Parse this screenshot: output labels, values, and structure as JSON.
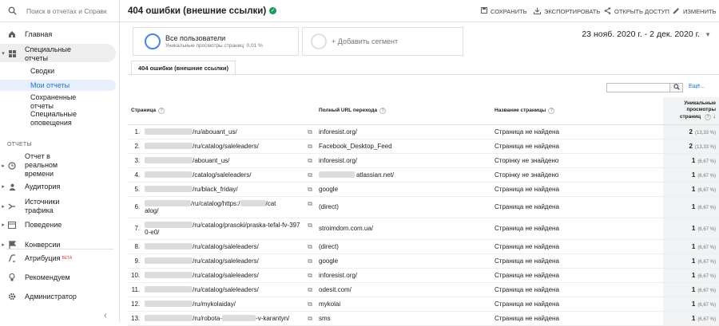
{
  "sidebar": {
    "search_placeholder": "Поиск в отчетах и Справк",
    "home": "Главная",
    "custom_reports": "Специальные отчеты",
    "sub_overviews": "Сводки",
    "sub_my_reports": "Мои отчеты",
    "sub_saved": "Сохраненные отчеты",
    "sub_alerts": "Специальные оповещения",
    "section_reports": "ОТЧЕТЫ",
    "realtime": "Отчет в реальном времени",
    "audience": "Аудитория",
    "acquisition": "Источники трафика",
    "behavior": "Поведение",
    "conversions": "Конверсии",
    "attribution": "Атрибуция",
    "beta": "BETA",
    "discover": "Рекомендуем",
    "admin": "Администратор"
  },
  "header": {
    "title": "404 ошибки (внешние ссылки)",
    "save": "СОХРАНИТЬ",
    "export": "ЭКСПОРТИРОВАТЬ",
    "share": "ОТКРЫТЬ ДОСТУП",
    "edit": "ИЗМЕНИТЬ"
  },
  "segments": {
    "all_users": "Все пользователи",
    "all_users_sub": "Уникальные просмотры страниц: 0,01 %",
    "add_segment": "+ Добавить сегмент"
  },
  "date_range": "23 нояб. 2020 г. - 2 дек. 2020 г.",
  "tab_label": "404 ошибки (внешние ссылки)",
  "table_controls": {
    "more": "Ещё..."
  },
  "table": {
    "col_page": "Страница",
    "col_referrer": "Полный URL перехода",
    "col_title": "Название страницы",
    "col_metric": "Уникальные просмотры страниц",
    "rows": [
      {
        "n": "1.",
        "page": "/ru/abouant_us/",
        "ref": "inforesist.org/",
        "title": "Страница не найдена",
        "val": "2",
        "pct": "(13,33 %)"
      },
      {
        "n": "2.",
        "page": "/ru/catalog/saleleaders/",
        "ref": "Facebook_Desktop_Feed",
        "title": "Страница не найдена",
        "val": "2",
        "pct": "(13,33 %)"
      },
      {
        "n": "3.",
        "page": "/abouant_us/",
        "ref": "inforesist.org/",
        "title": "Сторінку не знайдено",
        "val": "1",
        "pct": "(6,67 %)"
      },
      {
        "n": "4.",
        "page": "/catalog/saleleaders/",
        "ref": "atlassian.net/",
        "title": "Сторінку не знайдено",
        "val": "1",
        "pct": "(6,67 %)"
      },
      {
        "n": "5.",
        "page": "/ru/black_friday/",
        "ref": "google",
        "title": "Страница не найдена",
        "val": "1",
        "pct": "(6,67 %)"
      },
      {
        "n": "6.",
        "page": "/ru/catalog/https:/",
        "page2": "alog/",
        "page_end": "/cat",
        "ref": "(direct)",
        "title": "Страница не найдена",
        "val": "1",
        "pct": "(6,67 %)"
      },
      {
        "n": "7.",
        "page": "/ru/catalog/prasoki/praska-tefal-fv-397",
        "page2": "0-e0/",
        "ref": "stroimdom.com.ua/",
        "title": "Страница не найдена",
        "val": "1",
        "pct": "(6,67 %)"
      },
      {
        "n": "8.",
        "page": "/ru/catalog/saleleaders/",
        "ref": "(direct)",
        "title": "Страница не найдена",
        "val": "1",
        "pct": "(6,67 %)"
      },
      {
        "n": "9.",
        "page": "/ru/catalog/saleleaders/",
        "ref": "google",
        "title": "Страница не найдена",
        "val": "1",
        "pct": "(6,67 %)"
      },
      {
        "n": "10.",
        "page": "/ru/catalog/saleleaders/",
        "ref": "inforesist.org/",
        "title": "Страница не найдена",
        "val": "1",
        "pct": "(6,67 %)"
      },
      {
        "n": "11.",
        "page": "/ru/catalog/saleleaders/",
        "ref": "odesit.com/",
        "title": "Страница не найдена",
        "val": "1",
        "pct": "(6,67 %)"
      },
      {
        "n": "12.",
        "page": "/ru/mykolaiday/",
        "ref": "mykolai",
        "title": "Страница не найдена",
        "val": "1",
        "pct": "(6,67 %)"
      },
      {
        "n": "13.",
        "page": "/ru/robota-",
        "page_end": "-v-karantyn/",
        "ref": "sms",
        "title": "Страница не найдена",
        "val": "1",
        "pct": "(6,67 %)"
      }
    ]
  },
  "colors": {
    "accent": "#1a73e8",
    "verified": "#0f9d58",
    "beta": "#e53935"
  }
}
